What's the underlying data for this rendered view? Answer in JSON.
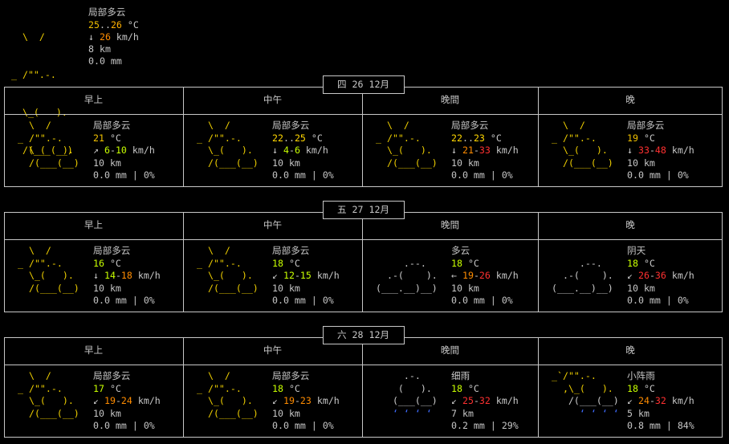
{
  "current": {
    "art": [
      "  \\  /",
      "_ /\"\".-.",
      "  \\_(   ).",
      "  /(___(__)"
    ],
    "desc": "局部多云",
    "temp_lo": "25",
    "temp_hi": "26",
    "temp_unit": " °C",
    "wind_arrow": "↓",
    "wind": "26",
    "wind_unit": " km/h",
    "visibility": "8 km",
    "precip": "0.0 mm"
  },
  "days": [
    {
      "label": "四 26 12月",
      "periods": [
        "早上",
        "中午",
        "晚間",
        "晚"
      ],
      "slots": [
        {
          "art": [
            "  \\  /",
            "_ /\"\".-.",
            "  \\_(   ).",
            "  /(___(__)"
          ],
          "desc": "局部多云",
          "temp": "21",
          "temp_hi": "",
          "arrow": "↗",
          "wind_lo": "6",
          "wind_hi": "10",
          "vis": "10 km",
          "precip": "0.0 mm | 0%"
        },
        {
          "art": [
            "  \\  /",
            "_ /\"\".-.",
            "  \\_(   ).",
            "  /(___(__)"
          ],
          "desc": "局部多云",
          "temp": "22",
          "temp_hi": "25",
          "arrow": "↓",
          "wind_lo": "4",
          "wind_hi": "6",
          "vis": "10 km",
          "precip": "0.0 mm | 0%"
        },
        {
          "art": [
            "  \\  /",
            "_ /\"\".-.",
            "  \\_(   ).",
            "  /(___(__)"
          ],
          "desc": "局部多云",
          "temp": "22",
          "temp_hi": "23",
          "arrow": "↓",
          "wind_lo": "21",
          "wind_hi": "33",
          "vis": "10 km",
          "precip": "0.0 mm | 0%"
        },
        {
          "art": [
            "  \\  /",
            "_ /\"\".-.",
            "  \\_(   ).",
            "  /(___(__)"
          ],
          "desc": "局部多云",
          "temp": "19",
          "temp_hi": "",
          "arrow": "↓",
          "wind_lo": "33",
          "wind_hi": "48",
          "vis": "10 km",
          "precip": "0.0 mm | 0%"
        }
      ]
    },
    {
      "label": "五 27 12月",
      "periods": [
        "早上",
        "中午",
        "晚間",
        "晚"
      ],
      "slots": [
        {
          "art": [
            "  \\  /",
            "_ /\"\".-.",
            "  \\_(   ).",
            "  /(___(__)"
          ],
          "desc": "局部多云",
          "temp": "16",
          "temp_hi": "",
          "arrow": "↓",
          "wind_lo": "14",
          "wind_hi": "18",
          "vis": "10 km",
          "precip": "0.0 mm | 0%"
        },
        {
          "art": [
            "  \\  /",
            "_ /\"\".-.",
            "  \\_(   ).",
            "  /(___(__)"
          ],
          "desc": "局部多云",
          "temp": "18",
          "temp_hi": "",
          "arrow": "↙",
          "wind_lo": "12",
          "wind_hi": "15",
          "vis": "10 km",
          "precip": "0.0 mm | 0%"
        },
        {
          "art": [
            "",
            "     .--.",
            "  .-(    ).",
            "(___.__)__)"
          ],
          "desc": "多云",
          "temp": "18",
          "temp_hi": "",
          "arrow": "←",
          "wind_lo": "19",
          "wind_hi": "26",
          "vis": "10 km",
          "precip": "0.0 mm | 0%"
        },
        {
          "art": [
            "",
            "     .--.",
            "  .-(    ).",
            "(___.__)__)"
          ],
          "desc": "阴天",
          "temp": "18",
          "temp_hi": "",
          "arrow": "↙",
          "wind_lo": "26",
          "wind_hi": "36",
          "vis": "10 km",
          "precip": "0.0 mm | 0%"
        }
      ]
    },
    {
      "label": "六 28 12月",
      "periods": [
        "早上",
        "中午",
        "晚間",
        "晚"
      ],
      "slots": [
        {
          "art": [
            "  \\  /",
            "_ /\"\".-.",
            "  \\_(   ).",
            "  /(___(__)"
          ],
          "desc": "局部多云",
          "temp": "17",
          "temp_hi": "",
          "arrow": "↙",
          "wind_lo": "19",
          "wind_hi": "24",
          "vis": "10 km",
          "precip": "0.0 mm | 0%"
        },
        {
          "art": [
            "  \\  /",
            "_ /\"\".-.",
            "  \\_(   ).",
            "  /(___(__)"
          ],
          "desc": "局部多云",
          "temp": "18",
          "temp_hi": "",
          "arrow": "↙",
          "wind_lo": "19",
          "wind_hi": "23",
          "vis": "10 km",
          "precip": "0.0 mm | 0%"
        },
        {
          "art": [
            "     .-.",
            "    (   ).",
            "   (___(__)",
            "   ‘ ‘ ‘ ‘"
          ],
          "desc": "细雨",
          "temp": "18",
          "temp_hi": "",
          "arrow": "↙",
          "wind_lo": "25",
          "wind_hi": "32",
          "vis": "7 km",
          "precip": "0.2 mm | 29%"
        },
        {
          "art": [
            "_`/\"\".-.",
            "  ,\\_(   ).",
            "   /(___(__)",
            "     ‘ ‘ ‘ ‘"
          ],
          "desc": "小阵雨",
          "temp": "18",
          "temp_hi": "",
          "arrow": "↙",
          "wind_lo": "24",
          "wind_hi": "32",
          "vis": "5 km",
          "precip": "0.8 mm | 84%"
        }
      ]
    }
  ],
  "colors": {
    "temp_warm": "#f0c000",
    "temp_mid": "#ffd700",
    "temp_cool": "#c8ff00",
    "wind_low": "#c8ff00",
    "wind_mid": "#ff8c00",
    "wind_high": "#ff3030",
    "rain": "#3f6cff"
  }
}
